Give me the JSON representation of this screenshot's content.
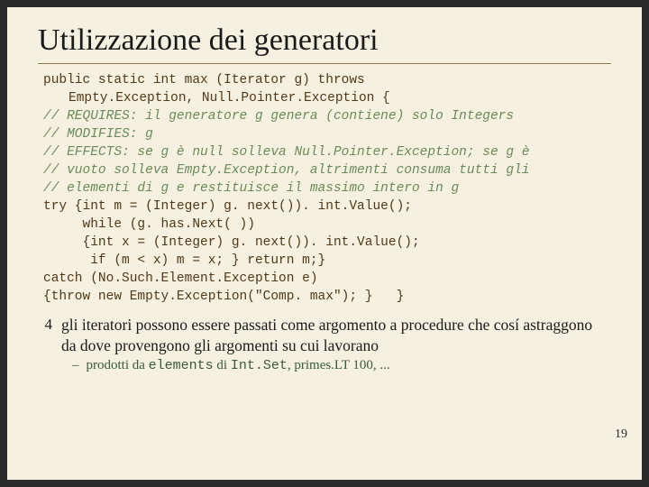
{
  "title": "Utilizzazione dei generatori",
  "code": {
    "sig1": "public static int max (Iterator g) throws",
    "sig2": "Empty.Exception, Null.Pointer.Exception {",
    "c1": "// REQUIRES: il generatore g genera (contiene) solo Integers",
    "c2": "// MODIFIES: g",
    "c3": "// EFFECTS: se g è null solleva Null.Pointer.Exception; se g è",
    "c4": "// vuoto solleva Empty.Exception, altrimenti consuma tutti gli",
    "c5": "// elementi di g e restituisce il massimo intero in g",
    "t1": "try {int m = (Integer) g. next()). int.Value();",
    "t2": "     while (g. has.Next( ))",
    "t3": "     {int x = (Integer) g. next()). int.Value();",
    "t4": "      if (m < x) m = x; } return m;}",
    "t5": "catch (No.Such.Element.Exception e)",
    "t6": "{throw new Empty.Exception(\"Comp. max\"); }   }"
  },
  "bullet": {
    "num": "4",
    "text": "gli iteratori possono essere passati come argomento a procedure che cosí astraggono da dove provengono gli argomenti su cui lavorano"
  },
  "sub": {
    "prefix": "prodotti da ",
    "elements": "elements",
    "mid": " di ",
    "intset": "Int.Set",
    "suffix": ", primes.LT 100, ..."
  },
  "page": "19"
}
